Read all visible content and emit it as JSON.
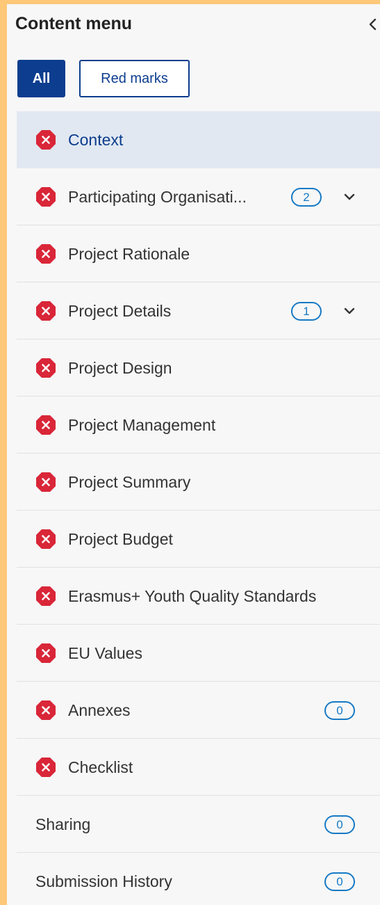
{
  "header": {
    "title": "Content menu",
    "collapse_icon": "chevron-left-icon"
  },
  "filters": {
    "all_label": "All",
    "red_marks_label": "Red marks"
  },
  "colors": {
    "accent": "#0d3d8e",
    "badge": "#1779c4",
    "error": "#d92638",
    "active_row": "#e1e8f1",
    "page_border": "#fdc878"
  },
  "menu": {
    "items": [
      {
        "label": "Context",
        "icon": "error-x-icon",
        "active": true
      },
      {
        "label": "Participating Organisati...",
        "icon": "error-x-icon",
        "count": "2",
        "expandable": true
      },
      {
        "label": "Project Rationale",
        "icon": "error-x-icon"
      },
      {
        "label": "Project Details",
        "icon": "error-x-icon",
        "count": "1",
        "expandable": true
      },
      {
        "label": "Project Design",
        "icon": "error-x-icon"
      },
      {
        "label": "Project Management",
        "icon": "error-x-icon"
      },
      {
        "label": "Project Summary",
        "icon": "error-x-icon"
      },
      {
        "label": "Project Budget",
        "icon": "error-x-icon"
      },
      {
        "label": "Erasmus+ Youth Quality Standards",
        "icon": "error-x-icon"
      },
      {
        "label": "EU Values",
        "icon": "error-x-icon"
      },
      {
        "label": "Annexes",
        "icon": "error-x-icon",
        "count": "0"
      },
      {
        "label": "Checklist",
        "icon": "error-x-icon"
      },
      {
        "label": "Sharing",
        "count": "0"
      },
      {
        "label": "Submission History",
        "count": "0"
      }
    ]
  }
}
